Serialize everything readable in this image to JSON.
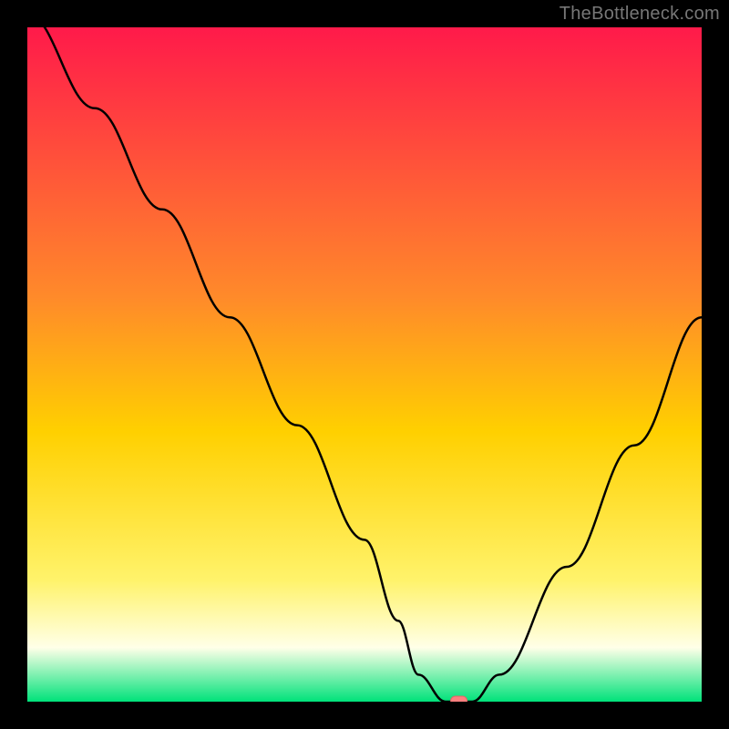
{
  "attribution": "TheBottleneck.com",
  "colors": {
    "frame_bg": "#000000",
    "gradient_top": "#ff1a4a",
    "gradient_mid1": "#ff8a2a",
    "gradient_mid2": "#ffd000",
    "gradient_mid3": "#fff36b",
    "gradient_pale": "#ffffe8",
    "gradient_bottom": "#00e27a",
    "curve": "#000000",
    "marker_fill": "#ff7f7f",
    "marker_stroke": "#e06666"
  },
  "chart_data": {
    "type": "line",
    "title": "",
    "xlabel": "",
    "ylabel": "",
    "xlim": [
      0,
      100
    ],
    "ylim": [
      0,
      100
    ],
    "x": [
      0,
      10,
      20,
      30,
      40,
      50,
      55,
      58,
      62,
      66,
      70,
      80,
      90,
      100
    ],
    "values": [
      102,
      88,
      73,
      57,
      41,
      24,
      12,
      4,
      0,
      0,
      4,
      20,
      38,
      57
    ],
    "optimum_marker": {
      "x": 64,
      "y": 0
    },
    "gradient_stops": [
      {
        "offset": 0,
        "meaning": "worst",
        "color_key": "gradient_top"
      },
      {
        "offset": 40,
        "meaning": "poor",
        "color_key": "gradient_mid1"
      },
      {
        "offset": 60,
        "meaning": "mediocre",
        "color_key": "gradient_mid2"
      },
      {
        "offset": 82,
        "meaning": "ok",
        "color_key": "gradient_mid3"
      },
      {
        "offset": 92,
        "meaning": "good",
        "color_key": "gradient_pale"
      },
      {
        "offset": 100,
        "meaning": "optimal",
        "color_key": "gradient_bottom"
      }
    ]
  }
}
